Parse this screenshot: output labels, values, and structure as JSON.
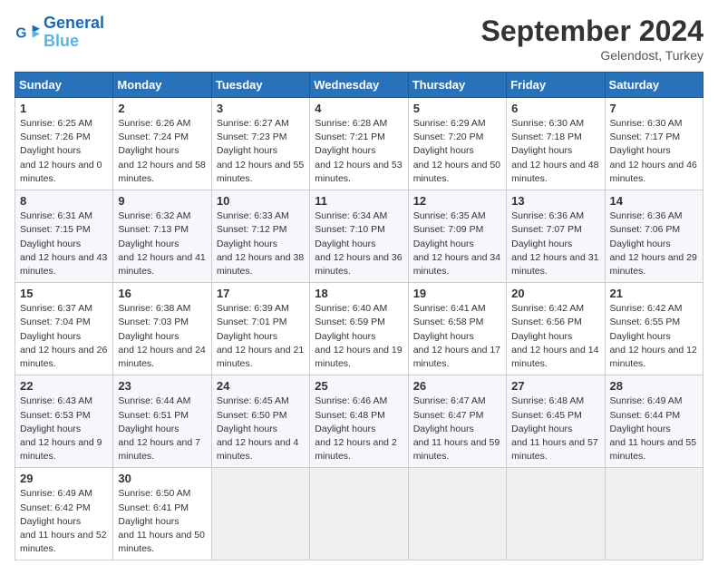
{
  "header": {
    "logo_line1": "General",
    "logo_line2": "Blue",
    "month": "September 2024",
    "location": "Gelendost, Turkey"
  },
  "days_of_week": [
    "Sunday",
    "Monday",
    "Tuesday",
    "Wednesday",
    "Thursday",
    "Friday",
    "Saturday"
  ],
  "weeks": [
    [
      {
        "day": 1,
        "rise": "6:25 AM",
        "set": "7:26 PM",
        "daylight": "12 hours and 0 minutes."
      },
      {
        "day": 2,
        "rise": "6:26 AM",
        "set": "7:24 PM",
        "daylight": "12 hours and 58 minutes."
      },
      {
        "day": 3,
        "rise": "6:27 AM",
        "set": "7:23 PM",
        "daylight": "12 hours and 55 minutes."
      },
      {
        "day": 4,
        "rise": "6:28 AM",
        "set": "7:21 PM",
        "daylight": "12 hours and 53 minutes."
      },
      {
        "day": 5,
        "rise": "6:29 AM",
        "set": "7:20 PM",
        "daylight": "12 hours and 50 minutes."
      },
      {
        "day": 6,
        "rise": "6:30 AM",
        "set": "7:18 PM",
        "daylight": "12 hours and 48 minutes."
      },
      {
        "day": 7,
        "rise": "6:30 AM",
        "set": "7:17 PM",
        "daylight": "12 hours and 46 minutes."
      }
    ],
    [
      {
        "day": 8,
        "rise": "6:31 AM",
        "set": "7:15 PM",
        "daylight": "12 hours and 43 minutes."
      },
      {
        "day": 9,
        "rise": "6:32 AM",
        "set": "7:13 PM",
        "daylight": "12 hours and 41 minutes."
      },
      {
        "day": 10,
        "rise": "6:33 AM",
        "set": "7:12 PM",
        "daylight": "12 hours and 38 minutes."
      },
      {
        "day": 11,
        "rise": "6:34 AM",
        "set": "7:10 PM",
        "daylight": "12 hours and 36 minutes."
      },
      {
        "day": 12,
        "rise": "6:35 AM",
        "set": "7:09 PM",
        "daylight": "12 hours and 34 minutes."
      },
      {
        "day": 13,
        "rise": "6:36 AM",
        "set": "7:07 PM",
        "daylight": "12 hours and 31 minutes."
      },
      {
        "day": 14,
        "rise": "6:36 AM",
        "set": "7:06 PM",
        "daylight": "12 hours and 29 minutes."
      }
    ],
    [
      {
        "day": 15,
        "rise": "6:37 AM",
        "set": "7:04 PM",
        "daylight": "12 hours and 26 minutes."
      },
      {
        "day": 16,
        "rise": "6:38 AM",
        "set": "7:03 PM",
        "daylight": "12 hours and 24 minutes."
      },
      {
        "day": 17,
        "rise": "6:39 AM",
        "set": "7:01 PM",
        "daylight": "12 hours and 21 minutes."
      },
      {
        "day": 18,
        "rise": "6:40 AM",
        "set": "6:59 PM",
        "daylight": "12 hours and 19 minutes."
      },
      {
        "day": 19,
        "rise": "6:41 AM",
        "set": "6:58 PM",
        "daylight": "12 hours and 17 minutes."
      },
      {
        "day": 20,
        "rise": "6:42 AM",
        "set": "6:56 PM",
        "daylight": "12 hours and 14 minutes."
      },
      {
        "day": 21,
        "rise": "6:42 AM",
        "set": "6:55 PM",
        "daylight": "12 hours and 12 minutes."
      }
    ],
    [
      {
        "day": 22,
        "rise": "6:43 AM",
        "set": "6:53 PM",
        "daylight": "12 hours and 9 minutes."
      },
      {
        "day": 23,
        "rise": "6:44 AM",
        "set": "6:51 PM",
        "daylight": "12 hours and 7 minutes."
      },
      {
        "day": 24,
        "rise": "6:45 AM",
        "set": "6:50 PM",
        "daylight": "12 hours and 4 minutes."
      },
      {
        "day": 25,
        "rise": "6:46 AM",
        "set": "6:48 PM",
        "daylight": "12 hours and 2 minutes."
      },
      {
        "day": 26,
        "rise": "6:47 AM",
        "set": "6:47 PM",
        "daylight": "11 hours and 59 minutes."
      },
      {
        "day": 27,
        "rise": "6:48 AM",
        "set": "6:45 PM",
        "daylight": "11 hours and 57 minutes."
      },
      {
        "day": 28,
        "rise": "6:49 AM",
        "set": "6:44 PM",
        "daylight": "11 hours and 55 minutes."
      }
    ],
    [
      {
        "day": 29,
        "rise": "6:49 AM",
        "set": "6:42 PM",
        "daylight": "11 hours and 52 minutes."
      },
      {
        "day": 30,
        "rise": "6:50 AM",
        "set": "6:41 PM",
        "daylight": "11 hours and 50 minutes."
      },
      null,
      null,
      null,
      null,
      null
    ]
  ]
}
